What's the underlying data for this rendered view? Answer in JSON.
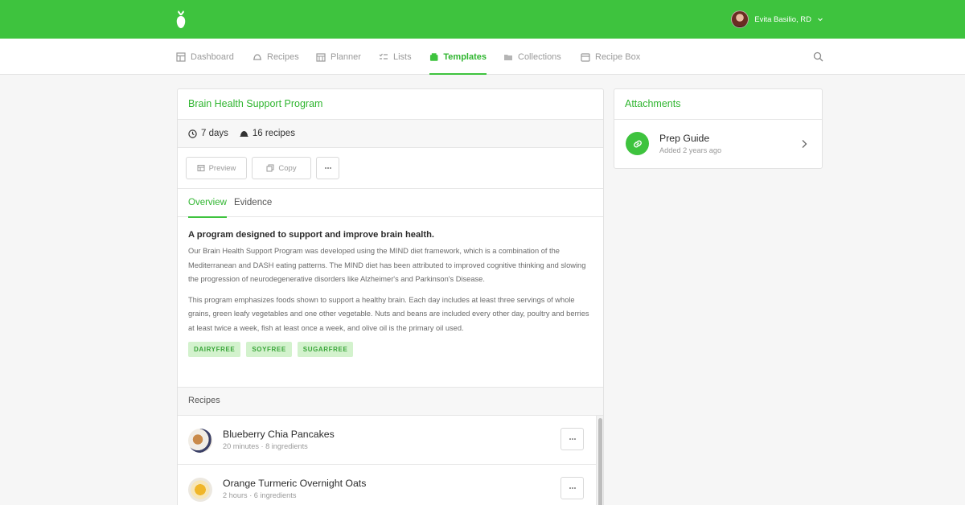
{
  "app": {
    "brand_color": "#3ec33e",
    "user_name": "Evita Basilio, RD"
  },
  "nav": {
    "items": [
      {
        "label": "Dashboard",
        "icon": "dashboard-icon"
      },
      {
        "label": "Recipes",
        "icon": "recipes-icon"
      },
      {
        "label": "Planner",
        "icon": "calendar-icon"
      },
      {
        "label": "Lists",
        "icon": "lists-icon"
      },
      {
        "label": "Templates",
        "icon": "templates-icon",
        "active": true
      },
      {
        "label": "Collections",
        "icon": "folder-icon"
      },
      {
        "label": "Recipe Box",
        "icon": "box-icon"
      }
    ],
    "search_icon": "search-icon"
  },
  "program": {
    "title": "Brain Health Support Program",
    "duration": "7 days",
    "recipe_count": "16 recipes",
    "actions": {
      "preview": "Preview",
      "copy": "Copy"
    },
    "tabs": [
      {
        "label": "Overview",
        "active": true
      },
      {
        "label": "Evidence"
      }
    ],
    "overview": {
      "heading": "A program designed to support and improve brain health.",
      "paragraphs": [
        "Our Brain Health Support Program was developed using the MIND diet framework, which is a combination of the Mediterranean and DASH eating patterns. The MIND diet has been attributed to improved cognitive thinking and slowing the progression of neurodegenerative disorders like Alzheimer's and Parkinson's Disease.",
        "This program emphasizes foods shown to support a healthy brain. Each day includes at least three servings of whole grains, green leafy vegetables and one other vegetable. Nuts and beans are included every other day, poultry and berries at least twice a week, fish at least once a week, and olive oil is the primary oil used."
      ],
      "tags": [
        "DAIRYFREE",
        "SOYFREE",
        "SUGARFREE"
      ]
    },
    "recipes_heading": "Recipes",
    "recipes": [
      {
        "name": "Blueberry Chia Pancakes",
        "meta": "20 minutes · 8 ingredients"
      },
      {
        "name": "Orange Turmeric Overnight Oats",
        "meta": "2 hours · 6 ingredients"
      }
    ]
  },
  "attachments": {
    "title": "Attachments",
    "items": [
      {
        "name": "Prep Guide",
        "meta": "Added 2 years ago",
        "icon": "link-icon"
      }
    ]
  }
}
